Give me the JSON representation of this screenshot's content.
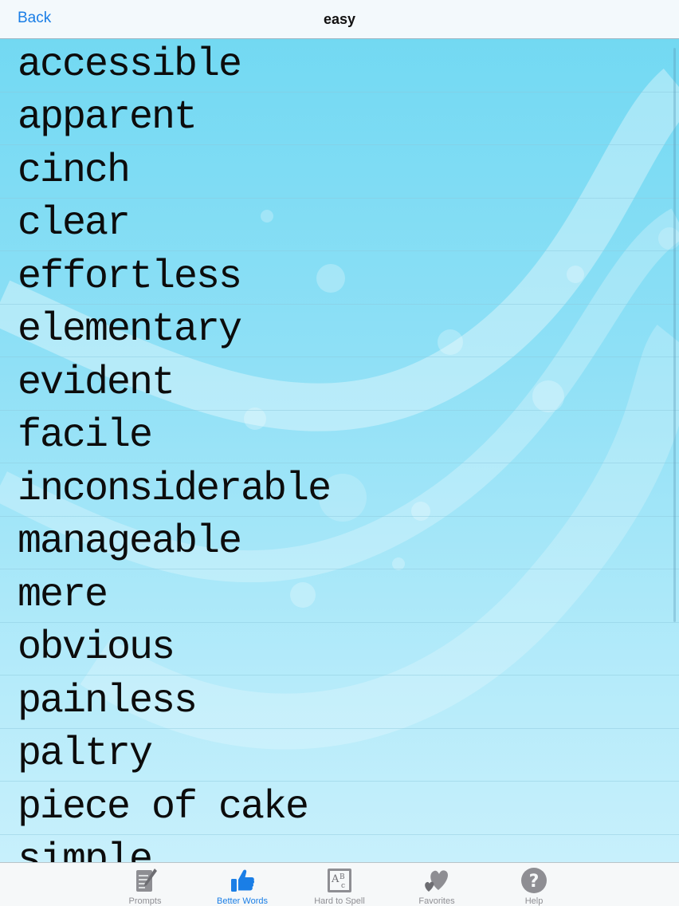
{
  "navbar": {
    "back_label": "Back",
    "title": "easy"
  },
  "words": [
    "accessible",
    "apparent",
    "cinch",
    "clear",
    "effortless",
    "elementary",
    "evident",
    "facile",
    "inconsiderable",
    "manageable",
    "mere",
    "obvious",
    "painless",
    "paltry",
    "piece of cake",
    "simple"
  ],
  "tabs": [
    {
      "label": "Prompts",
      "icon": "notepad-pencil-icon",
      "active": false
    },
    {
      "label": "Better Words",
      "icon": "thumbs-up-icon",
      "active": true
    },
    {
      "label": "Hard to Spell",
      "icon": "abc-book-icon",
      "active": false
    },
    {
      "label": "Favorites",
      "icon": "hearts-icon",
      "active": false
    },
    {
      "label": "Help",
      "icon": "question-icon",
      "active": false
    }
  ],
  "colors": {
    "accent": "#1a7ee6",
    "inactive": "#8e8e93",
    "background_top": "#6fd8f2",
    "background_bottom": "#ccf1fc"
  }
}
